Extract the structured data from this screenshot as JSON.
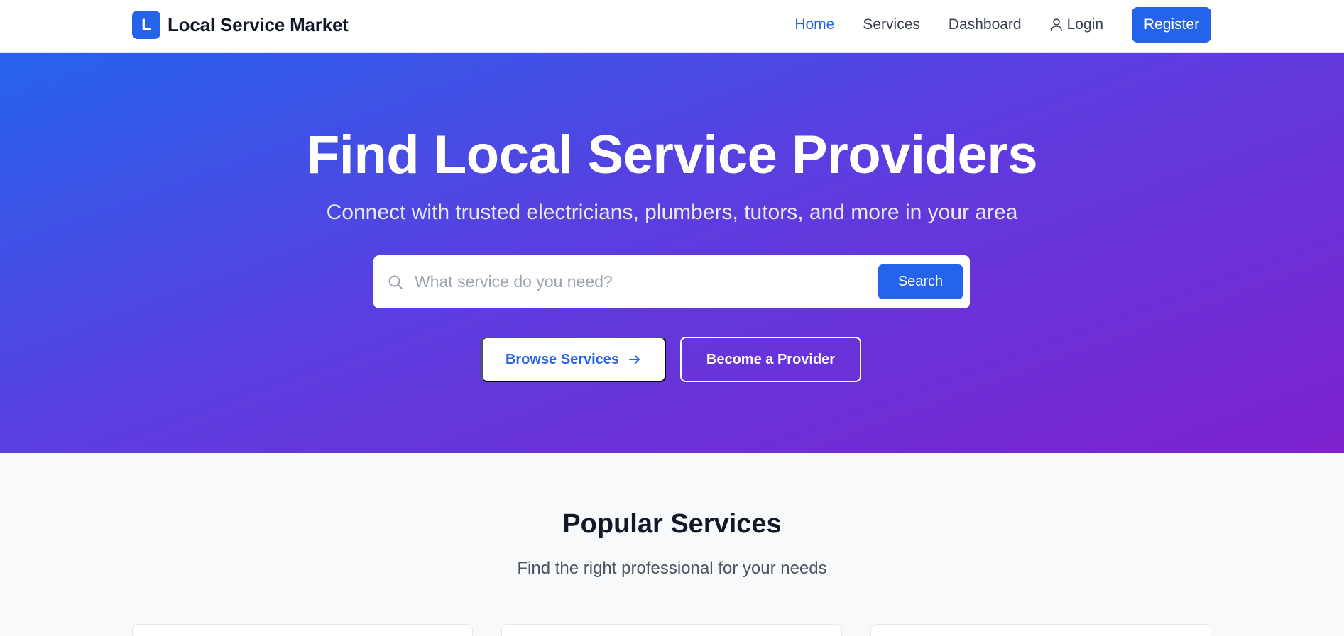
{
  "brand": {
    "logo_letter": "L",
    "name": "Local Service Market"
  },
  "nav": {
    "home": "Home",
    "services": "Services",
    "dashboard": "Dashboard",
    "login": "Login",
    "register": "Register"
  },
  "hero": {
    "title": "Find Local Service Providers",
    "subtitle": "Connect with trusted electricians, plumbers, tutors, and more in your area",
    "search_placeholder": "What service do you need?",
    "search_button": "Search",
    "browse_button": "Browse Services",
    "provider_button": "Become a Provider"
  },
  "popular": {
    "title": "Popular Services",
    "subtitle": "Find the right professional for your needs"
  },
  "colors": {
    "accent": "#2563eb",
    "gradient_start": "#2563eb",
    "gradient_end": "#7e22ce"
  },
  "icons": [
    "user-icon",
    "search-icon",
    "arrow-right-icon"
  ]
}
